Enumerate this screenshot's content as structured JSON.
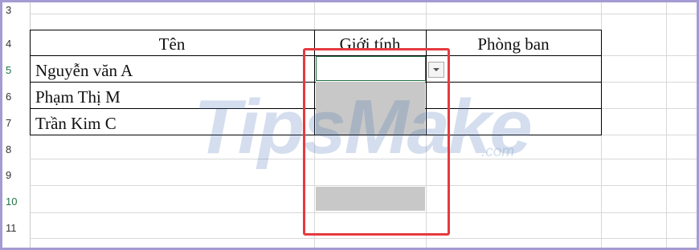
{
  "rows": [
    "3",
    "4",
    "5",
    "6",
    "7",
    "8",
    "9",
    "10",
    "11"
  ],
  "columns": {
    "name_header": "Tên",
    "gender_header": "Giới tính",
    "dept_header": "Phòng ban"
  },
  "people": [
    {
      "name": "Nguyễn văn A"
    },
    {
      "name": "Phạm Thị M"
    },
    {
      "name": "Trần Kim C"
    }
  ],
  "watermark": {
    "text": "TipsMake",
    "suffix": ".com"
  },
  "colors": {
    "frame": "#a59bd2",
    "highlight": "#e53a3f",
    "selection": "#217346",
    "list_fill": "#c8c8c8"
  },
  "icons": {
    "dropdown": "chevron-down-icon"
  }
}
